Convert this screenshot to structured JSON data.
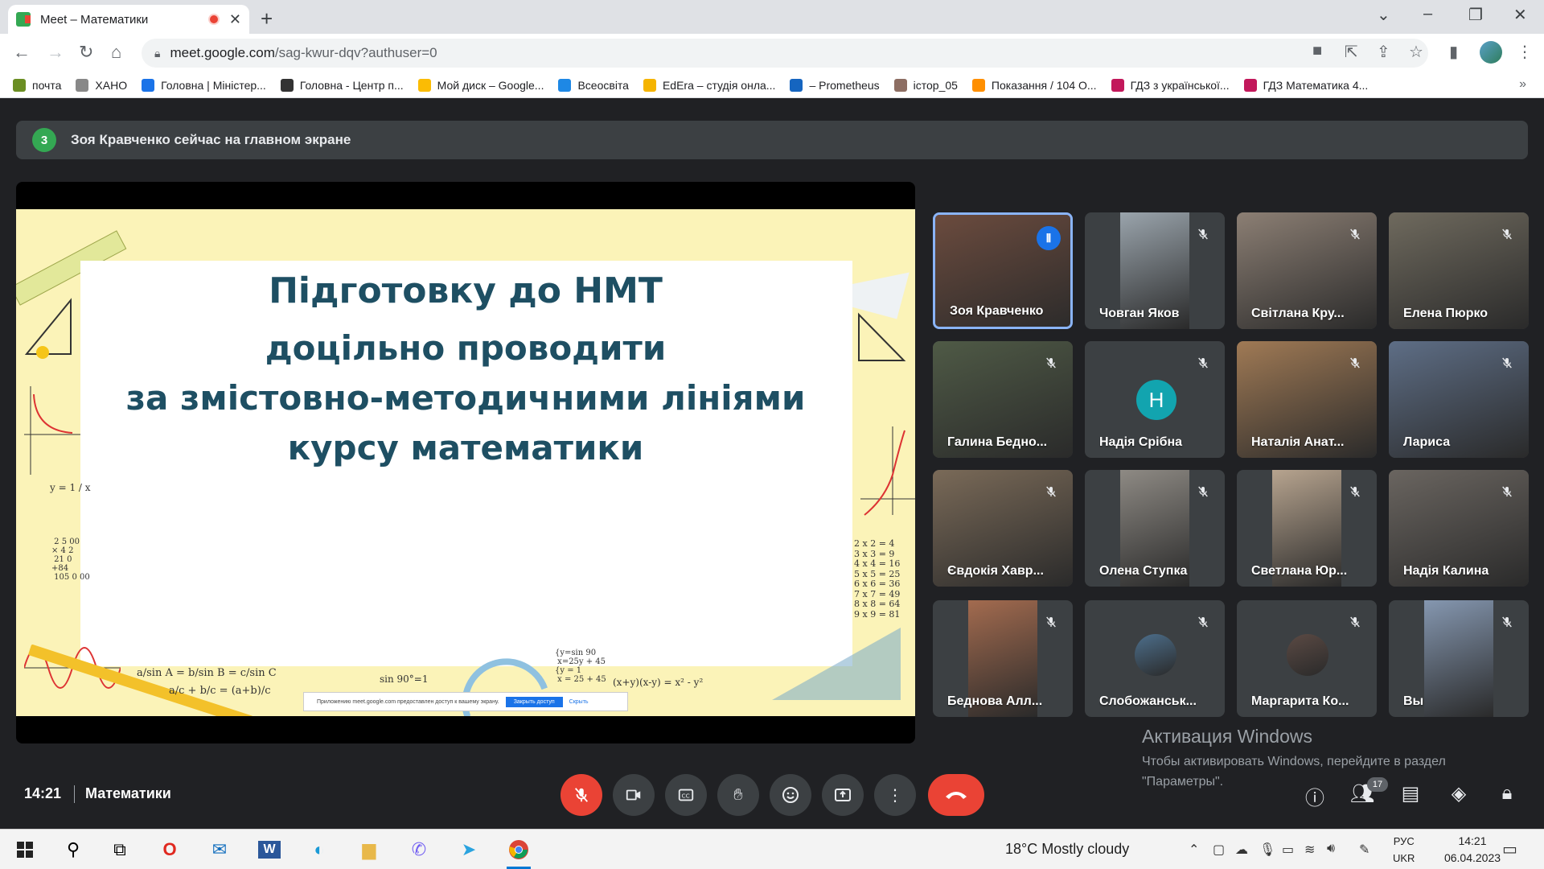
{
  "browser": {
    "tab_title": "Meet – Математики",
    "tab_close": "✕",
    "new_tab": "+",
    "url_host": "meet.google.com",
    "url_path": "/sag-kwur-dqv?authuser=0",
    "window_controls": {
      "chevron": "⌄",
      "minimize": "–",
      "restore": "❐",
      "close": "✕"
    },
    "bookmarks": [
      {
        "label": "почта",
        "color": "#6b8e23"
      },
      {
        "label": "ХАНО",
        "color": "#888888"
      },
      {
        "label": "Головна | Міністер...",
        "color": "#1a73e8"
      },
      {
        "label": "Головна - Центр п...",
        "color": "#333333"
      },
      {
        "label": "Мой диск – Google...",
        "color": "#fbbc04"
      },
      {
        "label": "Всеосвіта",
        "color": "#1e88e5"
      },
      {
        "label": "EdEra – студія онла...",
        "color": "#f5b400"
      },
      {
        "label": "– Prometheus",
        "color": "#1565c0"
      },
      {
        "label": "істор_05",
        "color": "#8d6e63"
      },
      {
        "label": "Показання / 104 О...",
        "color": "#ff8f00"
      },
      {
        "label": "ГДЗ з української...",
        "color": "#c2185b"
      },
      {
        "label": "ГДЗ Математика 4...",
        "color": "#c2185b"
      }
    ],
    "bookmarks_more": "»"
  },
  "meet": {
    "notice": {
      "badge": "3",
      "text": "Зоя Кравченко сейчас на главном экране"
    },
    "slide": {
      "line1": "Підготовку до НМТ",
      "line2": "доцільно проводити",
      "line3": "за змістовно-методичними лініями",
      "line4": "курсу математики",
      "share_text": "Приложению meet.google.com предоставлен доступ к вашему экрану.",
      "share_button": "Закрыть доступ",
      "share_hide": "Скрыть"
    },
    "participants": [
      {
        "name": "Зоя Кравченко",
        "state": "speaking",
        "color": "#6b4b3e"
      },
      {
        "name": "Човган Яков",
        "state": "muted",
        "color": "#9aa4ac"
      },
      {
        "name": "Світлана Кру...",
        "state": "muted",
        "color": "#8c7f74"
      },
      {
        "name": "Елена Пюрко",
        "state": "muted",
        "color": "#6f6a5e"
      },
      {
        "name": "Галина Бедно...",
        "state": "muted",
        "color": "#4f5a46"
      },
      {
        "name": "Надія Срібна",
        "state": "muted",
        "avatar_letter": "Н",
        "color": "#12a4af"
      },
      {
        "name": "Наталія Анат...",
        "state": "muted",
        "color": "#a07a55"
      },
      {
        "name": "Лариса",
        "state": "muted",
        "color": "#5e6e86"
      },
      {
        "name": "Євдокія Хавр...",
        "state": "muted",
        "color": "#7a6a58"
      },
      {
        "name": "Олена Ступка",
        "state": "muted",
        "color": "#8e8a84"
      },
      {
        "name": "Светлана Юр...",
        "state": "muted",
        "color": "#b7a48f"
      },
      {
        "name": "Надія Калина",
        "state": "muted",
        "color": "#6a6560"
      },
      {
        "name": "Беднова Алл...",
        "state": "muted",
        "color": "#a36b4f"
      },
      {
        "name": "Слобожанськ...",
        "state": "muted",
        "color": "#4d6f8c"
      },
      {
        "name": "Маргарита Ко...",
        "state": "muted",
        "color": "#5b4a44"
      },
      {
        "name": "Вы",
        "state": "muted",
        "color": "#8597b0"
      }
    ],
    "windows_activation": {
      "title": "Активация Windows",
      "text": "Чтобы активировать Windows, перейдите в раздел \"Параметры\"."
    },
    "bottom": {
      "time": "14:21",
      "meeting_title": "Математики",
      "people_count": "17"
    }
  },
  "taskbar": {
    "weather": "18°C  Mostly cloudy",
    "lang_top": "РУС",
    "lang_bottom": "UKR",
    "time": "14:21",
    "date": "06.04.2023"
  }
}
